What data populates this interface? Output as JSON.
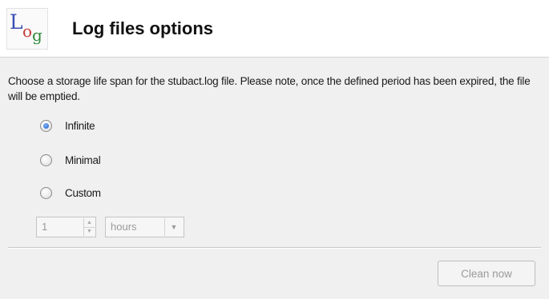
{
  "header": {
    "logo": {
      "icon": "log-logo-icon",
      "letters": [
        "L",
        "o",
        "g"
      ]
    },
    "title": "Log files options"
  },
  "description": "Choose a storage life span for the stubact.log file. Please note, once the defined period has been expired, the file will be emptied.",
  "options": [
    {
      "label": "Infinite",
      "checked": true
    },
    {
      "label": "Minimal",
      "checked": false
    },
    {
      "label": "Custom",
      "checked": false
    }
  ],
  "custom": {
    "amount": "1",
    "unit": "hours",
    "disabled": true
  },
  "buttons": {
    "clean_now": "Clean now"
  },
  "colors": {
    "radio_selected": "#1f5fc4",
    "disabled_text": "#9a9a9a",
    "logo_L": "#3a4fb5",
    "logo_o": "#c73a3a",
    "logo_g": "#2e8b3a"
  }
}
